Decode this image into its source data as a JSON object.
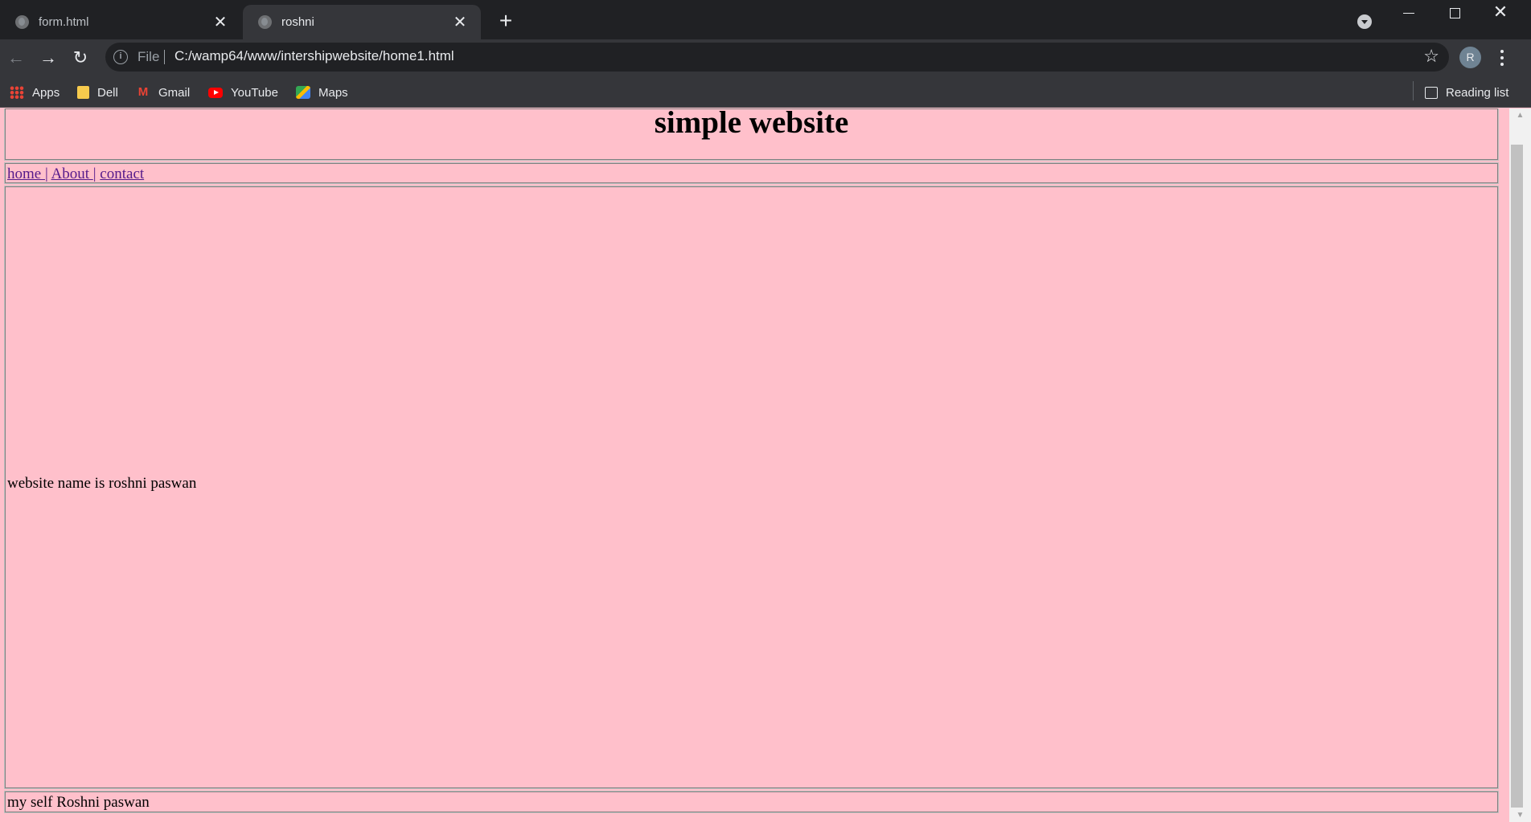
{
  "browser": {
    "tabs": [
      {
        "title": "form.html",
        "active": false
      },
      {
        "title": "roshni",
        "active": true
      }
    ],
    "new_tab_label": "+",
    "close_glyph": "✕",
    "address": {
      "chip": "File",
      "url": "C:/wamp64/www/intershipwebsite/home1.html"
    },
    "profile_initial": "R",
    "bookmarks": [
      {
        "label": "Apps",
        "icon": "apps-grid-icon"
      },
      {
        "label": "Dell",
        "icon": "folder-icon"
      },
      {
        "label": "Gmail",
        "icon": "gmail-icon"
      },
      {
        "label": "YouTube",
        "icon": "youtube-icon"
      },
      {
        "label": "Maps",
        "icon": "maps-icon"
      }
    ],
    "reading_list": "Reading list"
  },
  "page": {
    "title": "simple website",
    "nav_links": [
      "home ",
      "About ",
      "contact"
    ],
    "nav_separator": "|",
    "content_text": "website name is roshni paswan",
    "footer_text": "my self Roshni paswan",
    "background_color": "#ffc0cb",
    "link_color": "#551a8b"
  }
}
